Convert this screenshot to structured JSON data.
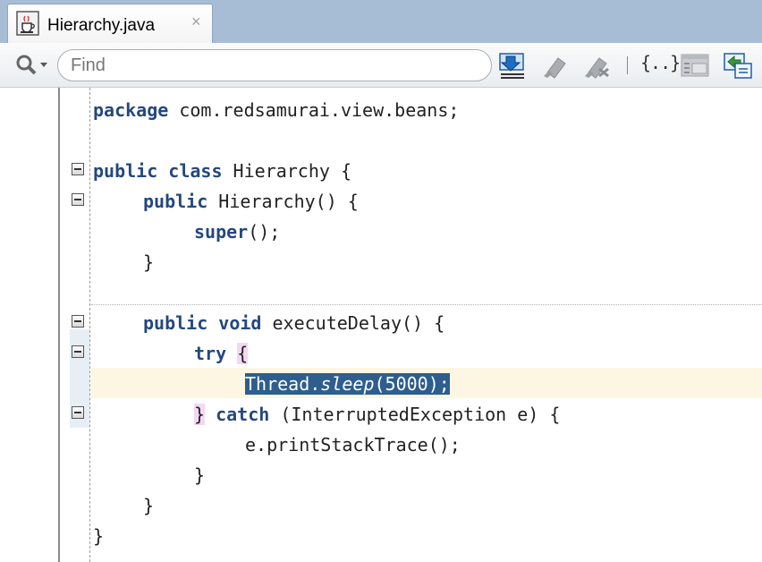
{
  "tab": {
    "title": "Hierarchy.java",
    "close_glyph": "×",
    "icon": "java-file-icon"
  },
  "toolbar": {
    "find_placeholder": "Find",
    "find_value": "",
    "braces_label": "{..}",
    "icons": [
      "search-menu-icon",
      "navigate-down-icon",
      "highlight-icon",
      "clear-highlight-icon",
      "braces-icon",
      "toggle-line-numbers-icon",
      "link-editor-icon"
    ]
  },
  "code": {
    "l1_kw": "package",
    "l1_rest": " com.redsamurai.view.beans;",
    "l3_kw1": "public",
    "l3_kw2": "class",
    "l3_rest": " Hierarchy {",
    "l4_kw": "public",
    "l4_rest": " Hierarchy() {",
    "l5_kw": "super",
    "l5_rest": "();",
    "l6": "}",
    "l8_kw1": "public",
    "l8_kw2": "void",
    "l8_rest": " executeDelay() {",
    "l9_kw": "try",
    "l9_brace": "{",
    "l10_a": "Thread.",
    "l10_b": "sleep",
    "l10_c": "(5000);",
    "l11_brace": "}",
    "l11_kw": "catch",
    "l11_rest": " (InterruptedException e) {",
    "l12": "e.printStackTrace();",
    "l13": "}",
    "l14": "}",
    "l15": "}"
  },
  "colors": {
    "keyword": "#24487e",
    "selection": "#2d5e8e",
    "current_line": "#fdf6e3",
    "brace_match": "#f3d8f4",
    "tab_strip": "#a7bdd6"
  }
}
